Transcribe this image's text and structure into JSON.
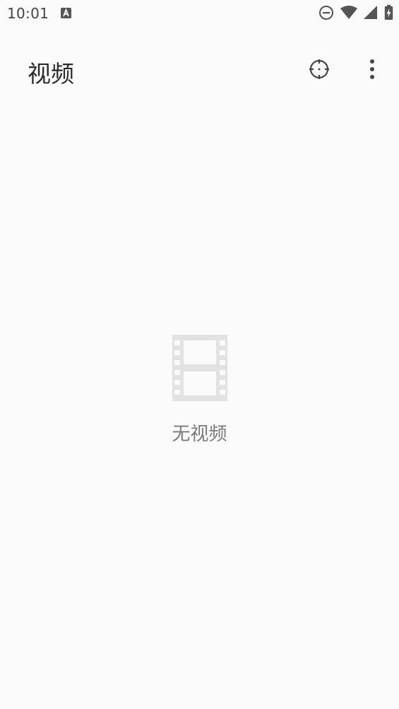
{
  "status_bar": {
    "time": "10:01",
    "notification_icon": "a-badge-icon",
    "icons": [
      "do-not-disturb-icon",
      "wifi-icon",
      "cell-signal-icon",
      "battery-charging-icon"
    ]
  },
  "app_bar": {
    "title": "视频",
    "actions": [
      "locate-icon",
      "more-vert-icon"
    ]
  },
  "empty_state": {
    "icon": "film-strip-icon",
    "message": "无视频"
  },
  "colors": {
    "background": "#fafafa",
    "title_text": "#2b2b2b",
    "empty_text": "#7a7a7a",
    "empty_icon": "#e2e2e2"
  }
}
